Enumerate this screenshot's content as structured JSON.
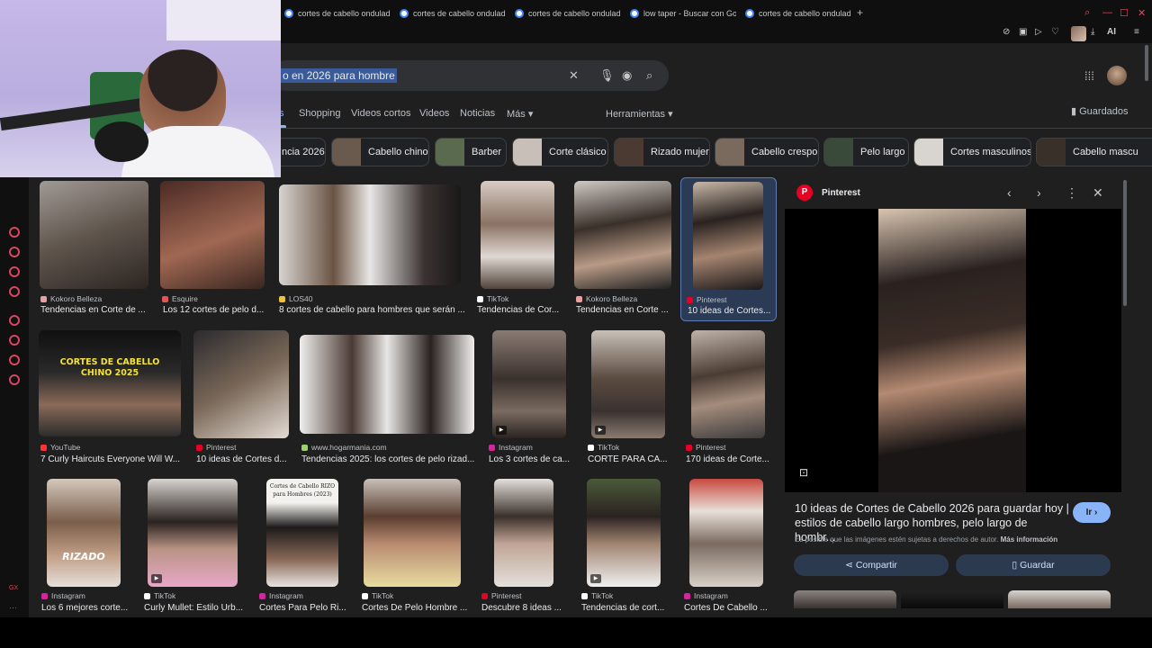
{
  "tabs": [
    {
      "label": "cortes de cabello ondulad"
    },
    {
      "label": "cortes de cabello ondulad"
    },
    {
      "label": "cortes de cabello ondulad"
    },
    {
      "label": "low taper - Buscar con Go"
    },
    {
      "label": "cortes de cabello ondulad"
    }
  ],
  "new_tab": "+",
  "toolbar": {
    "ai_label": "AI"
  },
  "search": {
    "query": "o en 2026 para hombre"
  },
  "nav": {
    "tabs": [
      "s",
      "Shopping",
      "Videos cortos",
      "Videos",
      "Noticias",
      "Más ▾"
    ],
    "tools": "Herramientas ▾",
    "saved": "Guardados"
  },
  "chips": [
    {
      "label": "ncia 2026"
    },
    {
      "label": "Cabello chino"
    },
    {
      "label": "Barber"
    },
    {
      "label": "Corte clásico"
    },
    {
      "label": "Rizado mujer"
    },
    {
      "label": "Cabello crespo"
    },
    {
      "label": "Pelo largo"
    },
    {
      "label": "Cortes masculinos"
    },
    {
      "label": "Cabello mascu"
    }
  ],
  "results": [
    {
      "source": "Kokoro Belleza",
      "title": "Tendencias en Corte de ...",
      "source_color": "#e8a0a0"
    },
    {
      "source": "Esquire",
      "title": "Los 12 cortes de pelo d...",
      "source_color": "#e05555"
    },
    {
      "source": "LOS40",
      "title": "8 cortes de cabello para hombres que serán ...",
      "source_color": "#f0c040"
    },
    {
      "source": "TikTok",
      "title": "Tendencias de Cor...",
      "source_color": "#ffffff"
    },
    {
      "source": "Kokoro Belleza",
      "title": "Tendencias en Corte ...",
      "source_color": "#e8a0a0"
    },
    {
      "source": "Pinterest",
      "title": "10 ideas de Cortes...",
      "source_color": "#e60023"
    },
    {
      "source": "YouTube",
      "title": "7 Curly Haircuts Everyone Will W...",
      "source_color": "#ff3333"
    },
    {
      "source": "Pinterest",
      "title": "10 ideas de Cortes d...",
      "source_color": "#e60023"
    },
    {
      "source": "www.hogarmania.com",
      "title": "Tendencias 2025: los cortes de pelo rizad...",
      "source_color": "#9bd36a"
    },
    {
      "source": "Instagram",
      "title": "Los 3 cortes de ca...",
      "source_color": "#d6249f"
    },
    {
      "source": "TikTok",
      "title": "CORTE PARA CA...",
      "source_color": "#ffffff"
    },
    {
      "source": "Pinterest",
      "title": "170 ideas de Corte...",
      "source_color": "#e60023"
    },
    {
      "source": "Instagram",
      "title": "Los 6 mejores corte...",
      "source_color": "#d6249f"
    },
    {
      "source": "TikTok",
      "title": "Curly Mullet: Estilo Urb...",
      "source_color": "#ffffff"
    },
    {
      "source": "Instagram",
      "title": "Cortes Para Pelo Ri...",
      "source_color": "#d6249f"
    },
    {
      "source": "TikTok",
      "title": "Cortes De Pelo Hombre ...",
      "source_color": "#ffffff"
    },
    {
      "source": "Pinterest",
      "title": "Descubre 8 ideas ...",
      "source_color": "#e60023"
    },
    {
      "source": "TikTok",
      "title": "Tendencias de cort...",
      "source_color": "#ffffff"
    },
    {
      "source": "Instagram",
      "title": "Cortes De Cabello ...",
      "source_color": "#d6249f"
    }
  ],
  "overlays": {
    "youtube_thumb_line1": "CORTES DE CABELLO",
    "youtube_thumb_line2": "CHINO 2025",
    "rizado": "RIZADO",
    "rizo_line1": "Cortes de Cabello RIZO",
    "rizo_line2": "para Hombres (2023)"
  },
  "panel": {
    "source": "Pinterest",
    "title": "10 ideas de Cortes de Cabello 2026 para guardar hoy | estilos de cabello largo hombres, pelo largo de hombr...",
    "go_label": "Ir ›",
    "copyright": "Es posible que las imágenes estén sujetas a derechos de autor.",
    "more_info": "Más información",
    "share_label": "Compartir",
    "save_label": "Guardar"
  },
  "dock": {
    "label": "GX"
  },
  "colors": {
    "accent": "#8ab4f8",
    "pinterest": "#e60023",
    "dock_icon": "#d9455f"
  }
}
